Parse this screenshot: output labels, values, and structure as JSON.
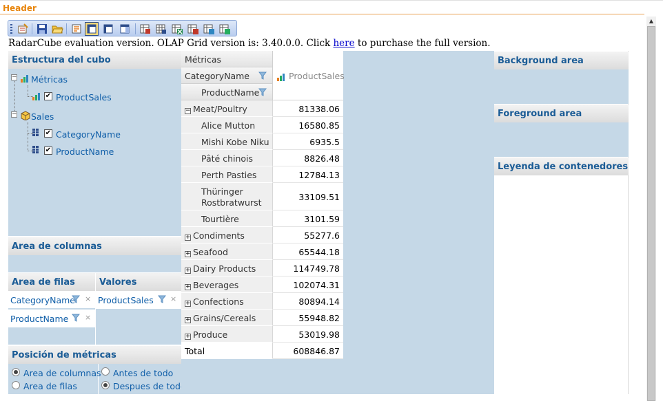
{
  "header": {
    "title": "Header"
  },
  "toolbar": {
    "buttons": [
      "design-icon",
      "save-icon",
      "open-icon",
      "wizard-icon",
      "layout-1-icon",
      "layout-2-icon",
      "layout-3-icon",
      "export-icon",
      "export-grid-icon",
      "export-excel-icon",
      "export-pdf-icon",
      "export-html-icon",
      "export-csv-icon"
    ]
  },
  "evaluation": {
    "before_link": "RadarCube evaluation version. OLAP Grid version is: 3.40.0.0. Click ",
    "link_text": "here",
    "after_link": " to purchase the full version."
  },
  "cube_structure": {
    "title": "Estructura del cubo",
    "measures_label": "Métricas",
    "measure_item": "ProductSales",
    "dimension_label": "Sales",
    "hierarchy_1": "CategoryName",
    "hierarchy_2": "ProductName"
  },
  "column_area": {
    "title": "Area de columnas"
  },
  "row_area": {
    "title": "Area de filas",
    "fields": [
      "CategoryName",
      "ProductName"
    ]
  },
  "values_area": {
    "title": "Valores",
    "fields": [
      "ProductSales"
    ]
  },
  "measure_position": {
    "title": "Posición de métricas",
    "options": [
      "Area de columnas",
      "Area de filas",
      "Antes de todo",
      "Despues de todo"
    ],
    "selected": [
      "Area de columnas",
      "Despues de todo"
    ]
  },
  "right_panel": {
    "background": "Background area",
    "foreground": "Foreground area",
    "legend": "Leyenda de contenedores"
  },
  "grid": {
    "metrics_label": "Métricas",
    "row_header_1": "CategoryName",
    "row_header_2": "ProductName",
    "measure_header": "ProductSales",
    "rows": [
      {
        "label": "Meat/Poultry",
        "value": "81338.06",
        "level": 0,
        "expander": "minus"
      },
      {
        "label": "Alice Mutton",
        "value": "16580.85",
        "level": 1
      },
      {
        "label": "Mishi Kobe Niku",
        "value": "6935.5",
        "level": 1
      },
      {
        "label": "Pâté chinois",
        "value": "8826.48",
        "level": 1
      },
      {
        "label": "Perth Pasties",
        "value": "12784.13",
        "level": 1
      },
      {
        "label": "Thüringer",
        "label2": "Rostbratwurst",
        "value": "33109.51",
        "level": 1
      },
      {
        "label": "Tourtière",
        "value": "3101.59",
        "level": 1
      },
      {
        "label": "Condiments",
        "value": "55277.6",
        "level": 0,
        "expander": "plus"
      },
      {
        "label": "Seafood",
        "value": "65544.18",
        "level": 0,
        "expander": "plus"
      },
      {
        "label": "Dairy Products",
        "value": "114749.78",
        "level": 0,
        "expander": "plus"
      },
      {
        "label": "Beverages",
        "value": "102074.31",
        "level": 0,
        "expander": "plus"
      },
      {
        "label": "Confections",
        "value": "80894.14",
        "level": 0,
        "expander": "plus"
      },
      {
        "label": "Grains/Cereals",
        "value": "55948.82",
        "level": 0,
        "expander": "plus"
      },
      {
        "label": "Produce",
        "value": "53019.98",
        "level": 0,
        "expander": "plus"
      },
      {
        "label": "Total",
        "value": "608846.87",
        "level": 0
      }
    ]
  },
  "colors": {
    "header": "#e8850c",
    "panel": "#c5d8e7",
    "link_text": "#0f5ea8"
  }
}
